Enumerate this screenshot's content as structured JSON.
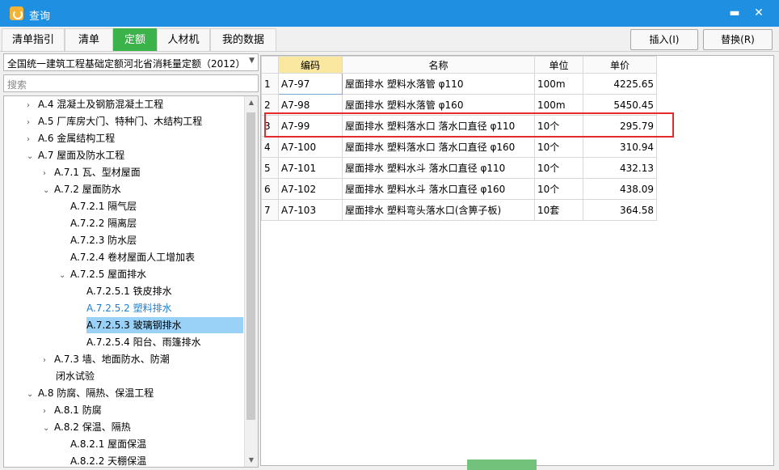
{
  "window": {
    "title": "查询",
    "min_label": "▬",
    "close_label": "✕"
  },
  "tabs": [
    {
      "label": "清单指引",
      "active": false
    },
    {
      "label": "清单",
      "active": false
    },
    {
      "label": "定额",
      "active": true
    },
    {
      "label": "人材机",
      "active": false
    },
    {
      "label": "我的数据",
      "active": false
    }
  ],
  "toolbar": {
    "insert_label": "插入(I)",
    "replace_label": "替换(R)"
  },
  "left": {
    "dropdown_value": "全国统一建筑工程基础定额河北省消耗量定额（2012）",
    "search_placeholder": "搜索",
    "tree": [
      {
        "toggle": "›",
        "label": "A.4 混凝土及钢筋混凝土工程"
      },
      {
        "toggle": "›",
        "label": "A.5 厂库房大门、特种门、木结构工程"
      },
      {
        "toggle": "›",
        "label": "A.6 金属结构工程"
      },
      {
        "toggle": "⌄",
        "label": "A.7 屋面及防水工程"
      },
      {
        "toggle": "›",
        "label": "A.7.1 瓦、型材屋面"
      },
      {
        "toggle": "⌄",
        "label": "A.7.2 屋面防水"
      },
      {
        "toggle": "",
        "label": "A.7.2.1 隔气层"
      },
      {
        "toggle": "",
        "label": "A.7.2.2 隔离层"
      },
      {
        "toggle": "",
        "label": "A.7.2.3 防水层"
      },
      {
        "toggle": "",
        "label": "A.7.2.4 卷材屋面人工增加表"
      },
      {
        "toggle": "⌄",
        "label": "A.7.2.5 屋面排水"
      },
      {
        "toggle": "",
        "label": "A.7.2.5.1 铁皮排水"
      },
      {
        "toggle": "",
        "label": "A.7.2.5.2 塑料排水"
      },
      {
        "toggle": "",
        "label": "A.7.2.5.3 玻璃钢排水"
      },
      {
        "toggle": "",
        "label": "A.7.2.5.4 阳台、雨篷排水"
      },
      {
        "toggle": "›",
        "label": "A.7.3 墙、地面防水、防潮"
      },
      {
        "toggle": "",
        "label": "闭水试验"
      },
      {
        "toggle": "⌄",
        "label": "A.8 防腐、隔热、保温工程"
      },
      {
        "toggle": "›",
        "label": "A.8.1 防腐"
      },
      {
        "toggle": "⌄",
        "label": "A.8.2 保温、隔热"
      },
      {
        "toggle": "",
        "label": "A.8.2.1 屋面保温"
      },
      {
        "toggle": "",
        "label": "A.8.2.2 天棚保温"
      }
    ]
  },
  "table": {
    "headers": [
      "编码",
      "名称",
      "单位",
      "单价"
    ],
    "rows": [
      {
        "no": "1",
        "code": "A7-97",
        "name": "屋面排水 塑料水落管 φ110",
        "unit": "100m",
        "price": "4225.65"
      },
      {
        "no": "2",
        "code": "A7-98",
        "name": "屋面排水 塑料水落管 φ160",
        "unit": "100m",
        "price": "5450.45"
      },
      {
        "no": "3",
        "code": "A7-99",
        "name": "屋面排水 塑料落水口 落水口直径 φ110",
        "unit": "10个",
        "price": "295.79"
      },
      {
        "no": "4",
        "code": "A7-100",
        "name": "屋面排水 塑料落水口 落水口直径 φ160",
        "unit": "10个",
        "price": "310.94"
      },
      {
        "no": "5",
        "code": "A7-101",
        "name": "屋面排水 塑料水斗 落水口直径 φ110",
        "unit": "10个",
        "price": "432.13"
      },
      {
        "no": "6",
        "code": "A7-102",
        "name": "屋面排水 塑料水斗 落水口直径 φ160",
        "unit": "10个",
        "price": "438.09"
      },
      {
        "no": "7",
        "code": "A7-103",
        "name": "屋面排水 塑料弯头落水口(含箅子板)",
        "unit": "10套",
        "price": "364.58"
      }
    ]
  },
  "colors": {
    "titlebar": "#1e8fe1",
    "active_tab": "#3bb24a",
    "selection": "#99d1f7",
    "highlight_box": "#e52b2b",
    "header_key": "#fbe8a0"
  }
}
